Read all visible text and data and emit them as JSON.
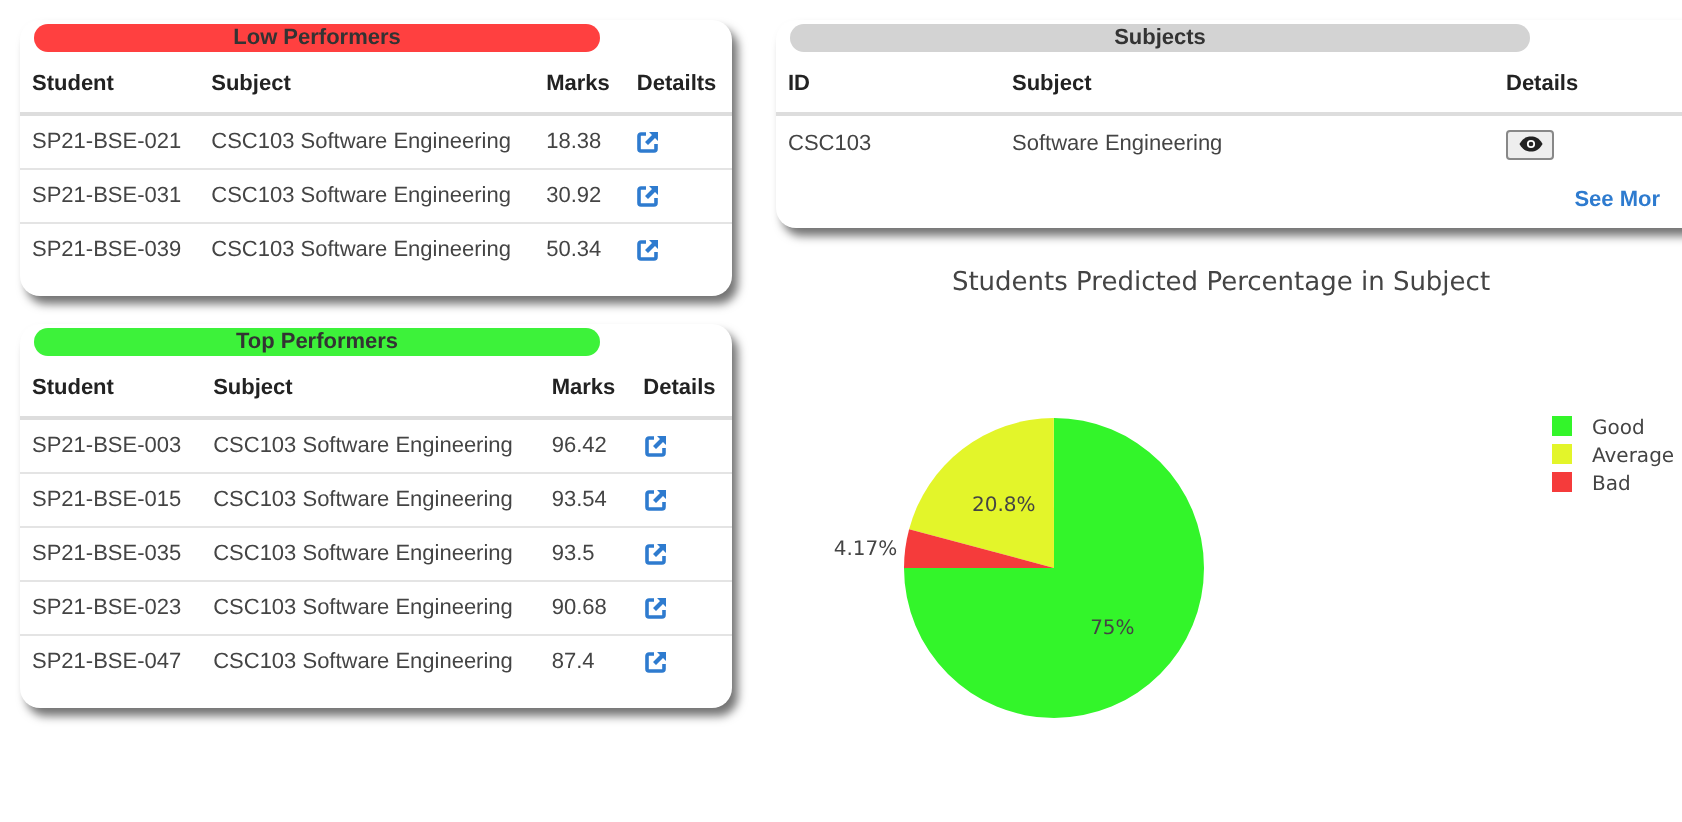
{
  "low_performers": {
    "title": "Low Performers",
    "columns": [
      "Student",
      "Subject",
      "Marks",
      "Detailts"
    ],
    "rows": [
      {
        "student": "SP21-BSE-021",
        "subject": "CSC103 Software Engineering",
        "marks": "18.38"
      },
      {
        "student": "SP21-BSE-031",
        "subject": "CSC103 Software Engineering",
        "marks": "30.92"
      },
      {
        "student": "SP21-BSE-039",
        "subject": "CSC103 Software Engineering",
        "marks": "50.34"
      }
    ]
  },
  "top_performers": {
    "title": "Top Performers",
    "columns": [
      "Student",
      "Subject",
      "Marks",
      "Details"
    ],
    "rows": [
      {
        "student": "SP21-BSE-003",
        "subject": "CSC103 Software Engineering",
        "marks": "96.42"
      },
      {
        "student": "SP21-BSE-015",
        "subject": "CSC103 Software Engineering",
        "marks": "93.54"
      },
      {
        "student": "SP21-BSE-035",
        "subject": "CSC103 Software Engineering",
        "marks": "93.5"
      },
      {
        "student": "SP21-BSE-023",
        "subject": "CSC103 Software Engineering",
        "marks": "90.68"
      },
      {
        "student": "SP21-BSE-047",
        "subject": "CSC103 Software Engineering",
        "marks": "87.4"
      }
    ]
  },
  "subjects": {
    "title": "Subjects",
    "columns": [
      "ID",
      "Subject",
      "Details"
    ],
    "rows": [
      {
        "id": "CSC103",
        "subject": "Software Engineering"
      }
    ],
    "see_more": "See Mor"
  },
  "chart": {
    "chart_data": {
      "type": "pie",
      "title": "Students Predicted Percentage in Subject",
      "categories": [
        "Good",
        "Average",
        "Bad"
      ],
      "series": [
        {
          "values": [
            75,
            20.8,
            4.17
          ],
          "value_labels": [
            "75%",
            "20.8%",
            "4.17%"
          ]
        }
      ],
      "colors": [
        "#33f52a",
        "#e3f52a",
        "#f53b3b"
      ],
      "data_labels": true,
      "legend": true
    }
  }
}
